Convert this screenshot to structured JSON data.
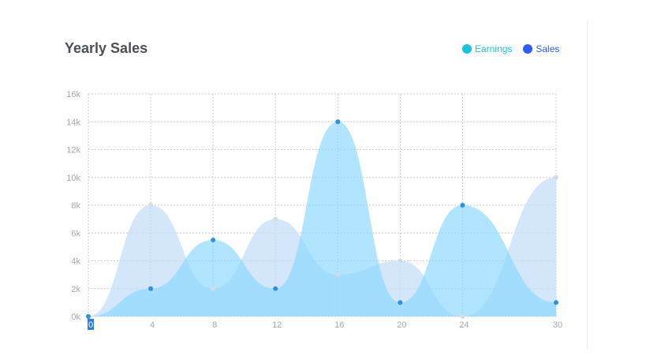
{
  "chart_data": {
    "type": "area",
    "title": "Yearly Sales",
    "x": [
      0,
      4,
      8,
      12,
      16,
      20,
      24,
      30
    ],
    "xlim": [
      0,
      30
    ],
    "ylim": [
      0,
      16000
    ],
    "y_ticks": [
      "0k",
      "2k",
      "4k",
      "6k",
      "8k",
      "10k",
      "12k",
      "14k",
      "16k"
    ],
    "x_ticks": [
      "0",
      "4",
      "8",
      "12",
      "16",
      "20",
      "24",
      "30"
    ],
    "grid": true,
    "legend_position": "top-right",
    "series": [
      {
        "name": "Earnings",
        "values": [
          0,
          8000,
          2000,
          7000,
          3000,
          4000,
          0,
          10000
        ],
        "legend_color": "#19c3dd",
        "fill": "#c6def8",
        "point_color": "#d4dbe3"
      },
      {
        "name": "Sales",
        "values": [
          0,
          2000,
          5500,
          2000,
          14000,
          1000,
          8000,
          1000
        ],
        "legend_color": "#2d5df6",
        "fill": "#8fd8ff",
        "point_color": "#2e8fe3"
      }
    ]
  }
}
